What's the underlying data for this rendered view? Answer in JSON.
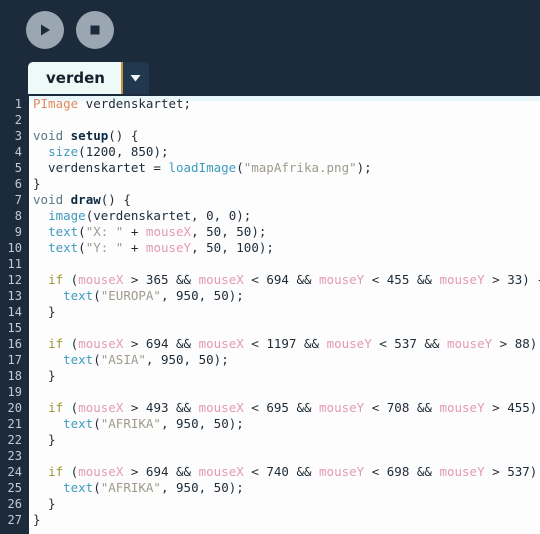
{
  "toolbar": {
    "run_button_label": "Run",
    "run_icon": "play-icon",
    "stop_button_label": "Stop",
    "stop_icon": "stop-icon"
  },
  "tab": {
    "name": "verden",
    "menu_icon": "chevron-down-icon"
  },
  "colors": {
    "chrome_bg": "#1b2b3c",
    "editor_bg": "#fdfdfd",
    "gutter_bg": "#1b2b3c",
    "line_number": "#c3ccd4",
    "tab_active_bg": "#eefaf8",
    "tab_accent": "#c8913f",
    "type": "#e08a5e",
    "keyword": "#5a7a8c",
    "function_name": "#0b2a42",
    "builtin_function": "#3f9bbf",
    "conditional": "#9a9a2e",
    "builtin_var": "#e49ab5",
    "string": "#a09a8e",
    "plain": "#1d2b38"
  },
  "editor": {
    "language": "Processing",
    "line_count": 27,
    "lines": [
      {
        "n": 1,
        "tokens": [
          {
            "t": "PImage",
            "c": "t-type"
          },
          {
            "t": " verdenskartet;",
            "c": "t-punc"
          }
        ]
      },
      {
        "n": 2,
        "tokens": []
      },
      {
        "n": 3,
        "tokens": [
          {
            "t": "void",
            "c": "t-kw"
          },
          {
            "t": " ",
            "c": "t-punc"
          },
          {
            "t": "setup",
            "c": "t-fname"
          },
          {
            "t": "() {",
            "c": "t-punc"
          }
        ]
      },
      {
        "n": 4,
        "tokens": [
          {
            "t": "  ",
            "c": "t-punc"
          },
          {
            "t": "size",
            "c": "t-fn"
          },
          {
            "t": "(",
            "c": "t-punc"
          },
          {
            "t": "1200",
            "c": "t-num"
          },
          {
            "t": ", ",
            "c": "t-punc"
          },
          {
            "t": "850",
            "c": "t-num"
          },
          {
            "t": ");",
            "c": "t-punc"
          }
        ]
      },
      {
        "n": 5,
        "tokens": [
          {
            "t": "  verdenskartet = ",
            "c": "t-punc"
          },
          {
            "t": "loadImage",
            "c": "t-fn"
          },
          {
            "t": "(",
            "c": "t-punc"
          },
          {
            "t": "\"mapAfrika.png\"",
            "c": "t-str"
          },
          {
            "t": ");",
            "c": "t-punc"
          }
        ]
      },
      {
        "n": 6,
        "tokens": [
          {
            "t": "}",
            "c": "t-punc"
          }
        ]
      },
      {
        "n": 7,
        "tokens": [
          {
            "t": "void",
            "c": "t-kw"
          },
          {
            "t": " ",
            "c": "t-punc"
          },
          {
            "t": "draw",
            "c": "t-fname"
          },
          {
            "t": "() {",
            "c": "t-punc"
          }
        ]
      },
      {
        "n": 8,
        "tokens": [
          {
            "t": "  ",
            "c": "t-punc"
          },
          {
            "t": "image",
            "c": "t-fn"
          },
          {
            "t": "(verdenskartet, ",
            "c": "t-punc"
          },
          {
            "t": "0",
            "c": "t-num"
          },
          {
            "t": ", ",
            "c": "t-punc"
          },
          {
            "t": "0",
            "c": "t-num"
          },
          {
            "t": ");",
            "c": "t-punc"
          }
        ]
      },
      {
        "n": 9,
        "tokens": [
          {
            "t": "  ",
            "c": "t-punc"
          },
          {
            "t": "text",
            "c": "t-fn"
          },
          {
            "t": "(",
            "c": "t-punc"
          },
          {
            "t": "\"X: \"",
            "c": "t-str"
          },
          {
            "t": " + ",
            "c": "t-punc"
          },
          {
            "t": "mouseX",
            "c": "t-var"
          },
          {
            "t": ", ",
            "c": "t-punc"
          },
          {
            "t": "50",
            "c": "t-num"
          },
          {
            "t": ", ",
            "c": "t-punc"
          },
          {
            "t": "50",
            "c": "t-num"
          },
          {
            "t": ");",
            "c": "t-punc"
          }
        ]
      },
      {
        "n": 10,
        "tokens": [
          {
            "t": "  ",
            "c": "t-punc"
          },
          {
            "t": "text",
            "c": "t-fn"
          },
          {
            "t": "(",
            "c": "t-punc"
          },
          {
            "t": "\"Y: \"",
            "c": "t-str"
          },
          {
            "t": " + ",
            "c": "t-punc"
          },
          {
            "t": "mouseY",
            "c": "t-var"
          },
          {
            "t": ", ",
            "c": "t-punc"
          },
          {
            "t": "50",
            "c": "t-num"
          },
          {
            "t": ", ",
            "c": "t-punc"
          },
          {
            "t": "100",
            "c": "t-num"
          },
          {
            "t": ");",
            "c": "t-punc"
          }
        ]
      },
      {
        "n": 11,
        "tokens": []
      },
      {
        "n": 12,
        "tokens": [
          {
            "t": "  ",
            "c": "t-punc"
          },
          {
            "t": "if",
            "c": "t-if"
          },
          {
            "t": " (",
            "c": "t-punc"
          },
          {
            "t": "mouseX",
            "c": "t-var"
          },
          {
            "t": " > ",
            "c": "t-punc"
          },
          {
            "t": "365",
            "c": "t-num"
          },
          {
            "t": " && ",
            "c": "t-punc"
          },
          {
            "t": "mouseX",
            "c": "t-var"
          },
          {
            "t": " < ",
            "c": "t-punc"
          },
          {
            "t": "694",
            "c": "t-num"
          },
          {
            "t": " && ",
            "c": "t-punc"
          },
          {
            "t": "mouseY",
            "c": "t-var"
          },
          {
            "t": " < ",
            "c": "t-punc"
          },
          {
            "t": "455",
            "c": "t-num"
          },
          {
            "t": " && ",
            "c": "t-punc"
          },
          {
            "t": "mouseY",
            "c": "t-var"
          },
          {
            "t": " > ",
            "c": "t-punc"
          },
          {
            "t": "33",
            "c": "t-num"
          },
          {
            "t": ") {",
            "c": "t-punc"
          }
        ]
      },
      {
        "n": 13,
        "tokens": [
          {
            "t": "    ",
            "c": "t-punc"
          },
          {
            "t": "text",
            "c": "t-fn"
          },
          {
            "t": "(",
            "c": "t-punc"
          },
          {
            "t": "\"EUROPA\"",
            "c": "t-str"
          },
          {
            "t": ", ",
            "c": "t-punc"
          },
          {
            "t": "950",
            "c": "t-num"
          },
          {
            "t": ", ",
            "c": "t-punc"
          },
          {
            "t": "50",
            "c": "t-num"
          },
          {
            "t": ");",
            "c": "t-punc"
          }
        ]
      },
      {
        "n": 14,
        "tokens": [
          {
            "t": "  }",
            "c": "t-punc"
          }
        ]
      },
      {
        "n": 15,
        "tokens": []
      },
      {
        "n": 16,
        "tokens": [
          {
            "t": "  ",
            "c": "t-punc"
          },
          {
            "t": "if",
            "c": "t-if"
          },
          {
            "t": " (",
            "c": "t-punc"
          },
          {
            "t": "mouseX",
            "c": "t-var"
          },
          {
            "t": " > ",
            "c": "t-punc"
          },
          {
            "t": "694",
            "c": "t-num"
          },
          {
            "t": " && ",
            "c": "t-punc"
          },
          {
            "t": "mouseX",
            "c": "t-var"
          },
          {
            "t": " < ",
            "c": "t-punc"
          },
          {
            "t": "1197",
            "c": "t-num"
          },
          {
            "t": " && ",
            "c": "t-punc"
          },
          {
            "t": "mouseY",
            "c": "t-var"
          },
          {
            "t": " < ",
            "c": "t-punc"
          },
          {
            "t": "537",
            "c": "t-num"
          },
          {
            "t": " && ",
            "c": "t-punc"
          },
          {
            "t": "mouseY",
            "c": "t-var"
          },
          {
            "t": " > ",
            "c": "t-punc"
          },
          {
            "t": "88",
            "c": "t-num"
          },
          {
            "t": ") {",
            "c": "t-punc"
          }
        ]
      },
      {
        "n": 17,
        "tokens": [
          {
            "t": "    ",
            "c": "t-punc"
          },
          {
            "t": "text",
            "c": "t-fn"
          },
          {
            "t": "(",
            "c": "t-punc"
          },
          {
            "t": "\"ASIA\"",
            "c": "t-str"
          },
          {
            "t": ", ",
            "c": "t-punc"
          },
          {
            "t": "950",
            "c": "t-num"
          },
          {
            "t": ", ",
            "c": "t-punc"
          },
          {
            "t": "50",
            "c": "t-num"
          },
          {
            "t": ");",
            "c": "t-punc"
          }
        ]
      },
      {
        "n": 18,
        "tokens": [
          {
            "t": "  }",
            "c": "t-punc"
          }
        ]
      },
      {
        "n": 19,
        "tokens": []
      },
      {
        "n": 20,
        "tokens": [
          {
            "t": "  ",
            "c": "t-punc"
          },
          {
            "t": "if",
            "c": "t-if"
          },
          {
            "t": " (",
            "c": "t-punc"
          },
          {
            "t": "mouseX",
            "c": "t-var"
          },
          {
            "t": " > ",
            "c": "t-punc"
          },
          {
            "t": "493",
            "c": "t-num"
          },
          {
            "t": " && ",
            "c": "t-punc"
          },
          {
            "t": "mouseX",
            "c": "t-var"
          },
          {
            "t": " < ",
            "c": "t-punc"
          },
          {
            "t": "695",
            "c": "t-num"
          },
          {
            "t": " && ",
            "c": "t-punc"
          },
          {
            "t": "mouseY",
            "c": "t-var"
          },
          {
            "t": " < ",
            "c": "t-punc"
          },
          {
            "t": "708",
            "c": "t-num"
          },
          {
            "t": " && ",
            "c": "t-punc"
          },
          {
            "t": "mouseY",
            "c": "t-var"
          },
          {
            "t": " > ",
            "c": "t-punc"
          },
          {
            "t": "455",
            "c": "t-num"
          },
          {
            "t": ") {",
            "c": "t-punc"
          }
        ]
      },
      {
        "n": 21,
        "tokens": [
          {
            "t": "    ",
            "c": "t-punc"
          },
          {
            "t": "text",
            "c": "t-fn"
          },
          {
            "t": "(",
            "c": "t-punc"
          },
          {
            "t": "\"AFRIKA\"",
            "c": "t-str"
          },
          {
            "t": ", ",
            "c": "t-punc"
          },
          {
            "t": "950",
            "c": "t-num"
          },
          {
            "t": ", ",
            "c": "t-punc"
          },
          {
            "t": "50",
            "c": "t-num"
          },
          {
            "t": ");",
            "c": "t-punc"
          }
        ]
      },
      {
        "n": 22,
        "tokens": [
          {
            "t": "  }",
            "c": "t-punc"
          }
        ]
      },
      {
        "n": 23,
        "tokens": []
      },
      {
        "n": 24,
        "tokens": [
          {
            "t": "  ",
            "c": "t-punc"
          },
          {
            "t": "if",
            "c": "t-if"
          },
          {
            "t": " (",
            "c": "t-punc"
          },
          {
            "t": "mouseX",
            "c": "t-var"
          },
          {
            "t": " > ",
            "c": "t-punc"
          },
          {
            "t": "694",
            "c": "t-num"
          },
          {
            "t": " && ",
            "c": "t-punc"
          },
          {
            "t": "mouseX",
            "c": "t-var"
          },
          {
            "t": " < ",
            "c": "t-punc"
          },
          {
            "t": "740",
            "c": "t-num"
          },
          {
            "t": " && ",
            "c": "t-punc"
          },
          {
            "t": "mouseY",
            "c": "t-var"
          },
          {
            "t": " < ",
            "c": "t-punc"
          },
          {
            "t": "698",
            "c": "t-num"
          },
          {
            "t": " && ",
            "c": "t-punc"
          },
          {
            "t": "mouseY",
            "c": "t-var"
          },
          {
            "t": " > ",
            "c": "t-punc"
          },
          {
            "t": "537",
            "c": "t-num"
          },
          {
            "t": ") {",
            "c": "t-punc"
          }
        ]
      },
      {
        "n": 25,
        "tokens": [
          {
            "t": "    ",
            "c": "t-punc"
          },
          {
            "t": "text",
            "c": "t-fn"
          },
          {
            "t": "(",
            "c": "t-punc"
          },
          {
            "t": "\"AFRIKA\"",
            "c": "t-str"
          },
          {
            "t": ", ",
            "c": "t-punc"
          },
          {
            "t": "950",
            "c": "t-num"
          },
          {
            "t": ", ",
            "c": "t-punc"
          },
          {
            "t": "50",
            "c": "t-num"
          },
          {
            "t": ");",
            "c": "t-punc"
          }
        ]
      },
      {
        "n": 26,
        "tokens": [
          {
            "t": "  }",
            "c": "t-punc"
          }
        ]
      },
      {
        "n": 27,
        "tokens": [
          {
            "t": "}",
            "c": "t-punc"
          }
        ]
      }
    ]
  }
}
